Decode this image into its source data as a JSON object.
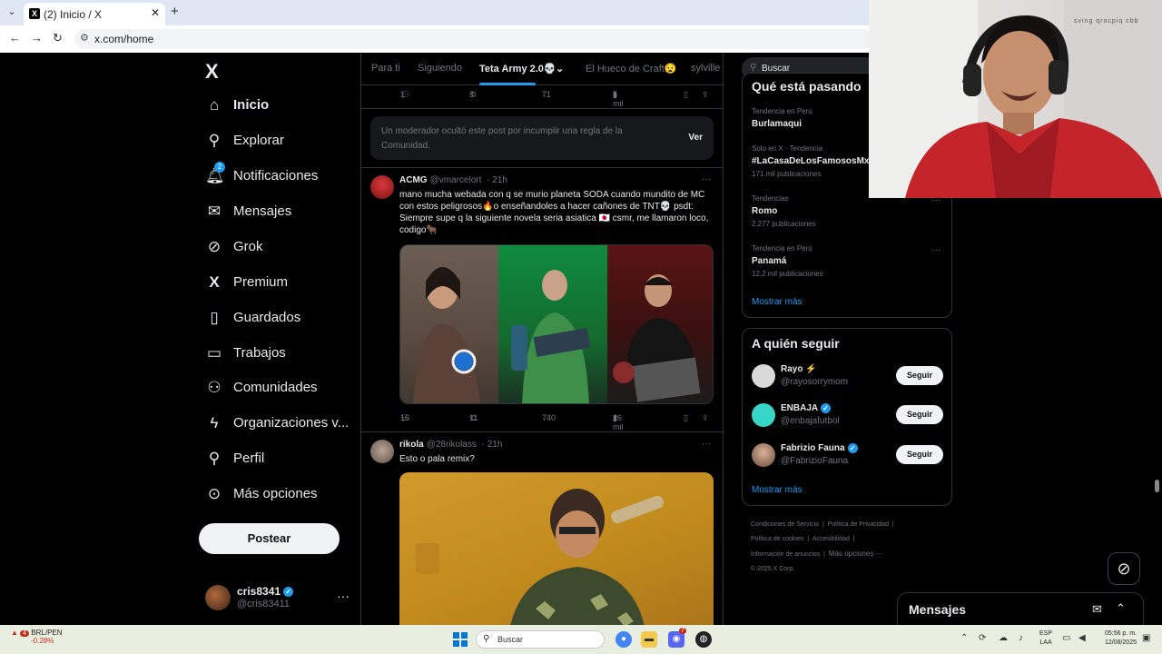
{
  "browser": {
    "tab_title": "(2) Inicio / X",
    "tab_favicon": "X",
    "url": "x.com/home",
    "icons": [
      "tab-list-icon",
      "close-icon",
      "plus-icon",
      "back-icon",
      "forward-icon",
      "reload-icon",
      "site-info-icon"
    ]
  },
  "sidebar": {
    "logo": "X",
    "items": [
      {
        "label": "Inicio",
        "icon": "home-icon"
      },
      {
        "label": "Explorar",
        "icon": "search-icon"
      },
      {
        "label": "Notificaciones",
        "icon": "bell-icon",
        "badge": "2"
      },
      {
        "label": "Mensajes",
        "icon": "mail-icon"
      },
      {
        "label": "Grok",
        "icon": "grok-icon"
      },
      {
        "label": "Premium",
        "icon": "x-icon"
      },
      {
        "label": "Guardados",
        "icon": "bookmark-icon"
      },
      {
        "label": "Trabajos",
        "icon": "briefcase-icon"
      },
      {
        "label": "Comunidades",
        "icon": "people-icon"
      },
      {
        "label": "Organizaciones v...",
        "icon": "lightning-icon"
      },
      {
        "label": "Perfil",
        "icon": "person-icon"
      },
      {
        "label": "Más opciones",
        "icon": "more-circle-icon"
      }
    ],
    "post_button": "Postear",
    "account": {
      "name": "cris8341",
      "handle": "@cris83411"
    }
  },
  "feed": {
    "tabs": [
      "Para ti",
      "Siguiendo",
      "Teta Army 2.0💀",
      "El Hueco de Craft😧",
      "sylville"
    ],
    "active_tab_index": 2,
    "top_actions": {
      "replies": "1",
      "reposts": "3",
      "likes": "71",
      "views": "5 mil"
    },
    "moderated_notice": "Un moderador ocultó este post por incumplir una regla de la Comunidad.",
    "moderated_action": "Ver",
    "posts": [
      {
        "name": "ACMG",
        "handle": "@vmarcelort",
        "time": "· 21h",
        "text": "mano mucha webada con q se murio planeta SODA cuando mundito de MC con estos peligrosos🔥o enseñandoles a hacer cañones de TNT💀 psdt: Siempre supe q la siguiente novela seria asiatica 🇯🇵 csmr, me llamaron loco, codigo🐂",
        "replies": "16",
        "reposts": "11",
        "likes": "740",
        "views": "26 mil"
      },
      {
        "name": "rikola",
        "handle": "@28rikolass",
        "time": "· 21h",
        "text": "Esto o pala remix?"
      }
    ]
  },
  "right": {
    "search_placeholder": "Buscar",
    "trends_title": "Qué está pasando",
    "trends": [
      {
        "meta": "Tendencia en Perú",
        "name": "Burlamaqui",
        "count": ""
      },
      {
        "meta": "Solo en X · Tendencia",
        "name": "#LaCasaDeLosFamososMx",
        "count": "171 mil publicaciones"
      },
      {
        "meta": "Tendencias",
        "name": "Romo",
        "count": "2.277 publicaciones"
      },
      {
        "meta": "Tendencia en Perú",
        "name": "Panamá",
        "count": "12,2 mil publicaciones"
      }
    ],
    "trends_more": "Mostrar más",
    "who_title": "A quién seguir",
    "who": [
      {
        "name": "Rayo ⚡",
        "handle": "@rayosorrymom",
        "verified": false,
        "button": "Seguir",
        "color": "#d9d9d9"
      },
      {
        "name": "ENBAJA",
        "handle": "@enbajafutbol",
        "verified": true,
        "button": "Seguir",
        "color": "#37d6c6"
      },
      {
        "name": "Fabrizio Fauna",
        "handle": "@FabrizioFauna",
        "verified": true,
        "button": "Seguir",
        "color": "#b07a5a"
      }
    ],
    "who_more": "Mostrar más",
    "footer": [
      "Condiciones de Servicio",
      "Política de Privacidad",
      "Política de cookies",
      "Accesibilidad",
      "Información de anuncios",
      "Más opciones ···",
      "© 2025 X Corp."
    ]
  },
  "floating": {
    "messages_title": "Mensajes"
  },
  "webcam": {
    "mirrored_text": "sving qrocpiq cbb"
  },
  "taskbar": {
    "stock_label": "BRL/PEN",
    "stock_change": "-0.28%",
    "stock_badge": "4",
    "search_placeholder": "Buscar",
    "discord_badge": "7",
    "lang_top": "ESP",
    "lang_bottom": "LAA",
    "time": "05:56 p. m.",
    "date": "12/08/2025"
  }
}
